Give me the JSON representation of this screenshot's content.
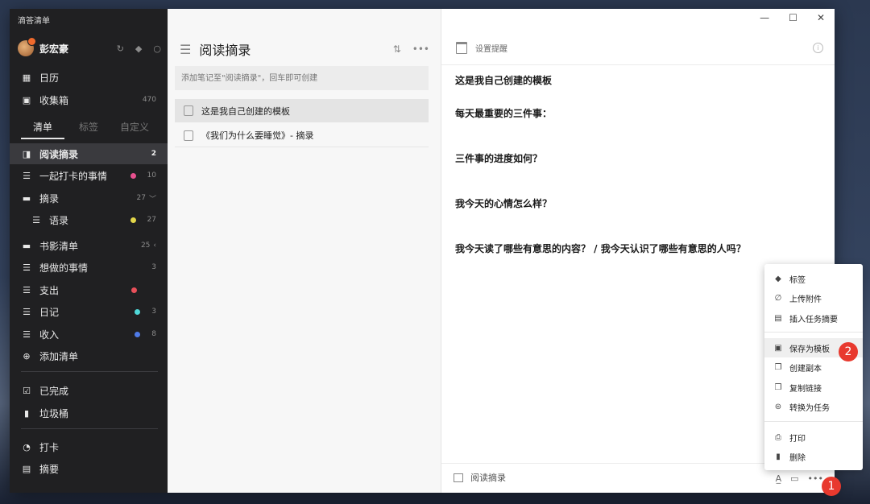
{
  "app": {
    "title": "滴答清单"
  },
  "user": {
    "name": "彭宏豪"
  },
  "sidebar": {
    "top_items": [
      {
        "label": "日历",
        "count": ""
      },
      {
        "label": "收集箱",
        "count": "470"
      }
    ],
    "tabs": [
      "清单",
      "标签",
      "自定义"
    ],
    "lists": [
      {
        "label": "阅读摘录",
        "count": "2",
        "dot": "",
        "suffix": ""
      },
      {
        "label": "一起打卡的事情",
        "count": "10",
        "dot": "#e8508f",
        "suffix": ""
      },
      {
        "label": "摘录",
        "count": "27",
        "dot": "",
        "suffix": "﹀"
      },
      {
        "label": "语录",
        "count": "27",
        "dot": "#e3d64a",
        "suffix": ""
      },
      {
        "label": "书影清单",
        "count": "25",
        "dot": "",
        "suffix": "‹"
      },
      {
        "label": "想做的事情",
        "count": "3",
        "dot": "",
        "suffix": ""
      },
      {
        "label": "支出",
        "count": "",
        "dot": "#e8505a",
        "suffix": ""
      },
      {
        "label": "日记",
        "count": "3",
        "dot": "#4fd8d8",
        "suffix": ""
      },
      {
        "label": "收入",
        "count": "8",
        "dot": "#4f7be8",
        "suffix": ""
      }
    ],
    "add_list": "添加清单",
    "bottom_items": [
      {
        "label": "已完成"
      },
      {
        "label": "垃圾桶"
      },
      {
        "label": "打卡"
      },
      {
        "label": "摘要"
      }
    ]
  },
  "list_panel": {
    "title": "阅读摘录",
    "add_placeholder": "添加笔记至\"阅读摘录\"，回车即可创建",
    "notes": [
      {
        "title": "这是我自己创建的模板"
      },
      {
        "title": "《我们为什么要睡觉》- 摘录"
      }
    ]
  },
  "detail": {
    "reminder": "设置提醒",
    "lines": [
      "这是我自己创建的模板",
      "每天最重要的三件事：",
      "三件事的进度如何？",
      "我今天的心情怎么样？",
      "我今天读了哪些有意思的内容？ / 我今天认识了哪些有意思的人吗？"
    ],
    "footer_list": "阅读摘录"
  },
  "context_menu": {
    "items": [
      {
        "label": "标签",
        "icon": "tag-icon"
      },
      {
        "label": "上传附件",
        "icon": "paperclip-icon"
      },
      {
        "label": "插入任务摘要",
        "icon": "clipboard-icon"
      },
      {
        "label": "保存为模板",
        "icon": "save-icon"
      },
      {
        "label": "创建副本",
        "icon": "copy-icon"
      },
      {
        "label": "复制链接",
        "icon": "link-icon"
      },
      {
        "label": "转换为任务",
        "icon": "convert-icon"
      },
      {
        "label": "打印",
        "icon": "print-icon"
      },
      {
        "label": "删除",
        "icon": "trash-icon"
      }
    ]
  },
  "annotations": {
    "badge1": "1",
    "badge2": "2"
  }
}
